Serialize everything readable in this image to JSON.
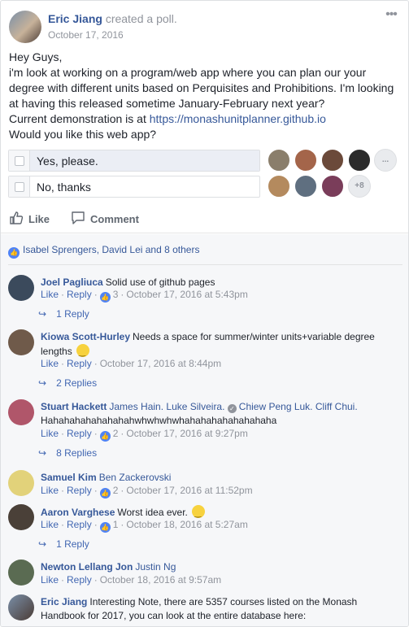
{
  "post": {
    "author": "Eric Jiang",
    "action": "created a poll.",
    "date": "October 17, 2016",
    "body_lines": [
      "Hey Guys,",
      "i'm look at working on a program/web app where you can plan our your",
      "degree with different units based on Perquisites and Prohibitions. I'm looking",
      "at having this released sometime January-February next year?",
      "Current demonstration is at ",
      "Would you like this web app?"
    ],
    "demo_link": "https://monashunitplanner.github.io",
    "more_icon": "ellipsis-icon"
  },
  "poll": {
    "options": [
      {
        "label": "Yes, please.",
        "vote_fraction": 1.0
      },
      {
        "label": "No, thanks",
        "vote_fraction": 0.0
      }
    ],
    "yes_more_label": "...",
    "no_more_label": "+8"
  },
  "actions": {
    "like_label": "Like",
    "comment_label": "Comment"
  },
  "likers": {
    "text": "Isabel Sprengers, David Lei and 8 others"
  },
  "comments": [
    {
      "name": "Joel Pagliuca",
      "text": "Solid use of github pages",
      "like": "Like",
      "reply": "Reply",
      "like_count": "3",
      "time": "October 17, 2016 at 5:43pm",
      "replies": "1 Reply"
    },
    {
      "name": "Kiowa Scott-Hurley",
      "text": "Needs a space for summer/winter units+variable degree lengths",
      "like": "Like",
      "reply": "Reply",
      "time": "October 17, 2016 at 8:44pm",
      "replies": "2 Replies"
    },
    {
      "name": "Stuart Hackett",
      "tags": [
        "James Hain.",
        "Luke Silveira.",
        "Chiew Peng Luk.",
        "Cliff Chui."
      ],
      "text": "Hahahahahahahahahwhwhwhwhahahahahahahahaha",
      "like": "Like",
      "reply": "Reply",
      "like_count": "2",
      "time": "October 17, 2016 at 9:27pm",
      "replies": "8 Replies"
    },
    {
      "name": "Samuel Kim",
      "tag": "Ben Zackerovski",
      "like": "Like",
      "reply": "Reply",
      "like_count": "2",
      "time": "October 17, 2016 at 11:52pm"
    },
    {
      "name": "Aaron Varghese",
      "text": "Worst idea ever.",
      "like": "Like",
      "reply": "Reply",
      "like_count": "1",
      "time": "October 18, 2016 at 5:27am",
      "replies": "1 Reply"
    },
    {
      "name": "Newton Lellang Jon",
      "tag": "Justin Ng",
      "like": "Like",
      "reply": "Reply",
      "time": "October 18, 2016 at 9:57am"
    },
    {
      "name": "Eric Jiang",
      "text": "Interesting Note, there are 5357 courses listed on the Monash Handbook for 2017, you can look at the entire database here:"
    }
  ],
  "colors": {
    "link": "#365899",
    "meta": "#90949c",
    "like_blue": "#4f83f5",
    "comment_bg": "#f6f7f9",
    "poll_fill": "#ebeef5"
  }
}
